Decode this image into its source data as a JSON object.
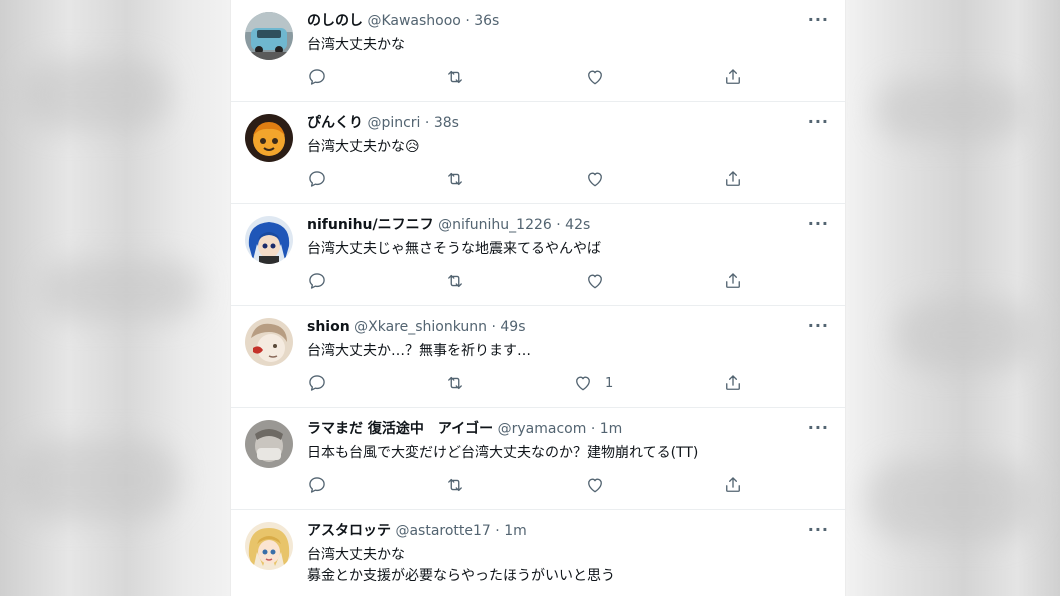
{
  "tweets": [
    {
      "display_name": "のしのし",
      "handle": "@Kawashooo",
      "time": "36s",
      "lines": [
        "台湾大丈夫かな"
      ],
      "avatar": "car-avatar",
      "like_count": ""
    },
    {
      "display_name": "ぴんくり",
      "handle": "@pincri",
      "time": "38s",
      "lines": [
        "台湾大丈夫かな😥"
      ],
      "avatar": "cartoon-face-avatar",
      "like_count": ""
    },
    {
      "display_name": "nifunihu/ニフニフ",
      "handle": "@nifunihu_1226",
      "time": "42s",
      "lines": [
        "台湾大丈夫じゃ無さそうな地震来てるやんやば"
      ],
      "avatar": "blue-hair-anime-avatar",
      "like_count": ""
    },
    {
      "display_name": "shion",
      "handle": "@Xkare_shionkunn",
      "time": "49s",
      "lines": [
        "台湾大丈夫か…？無事を祈ります…"
      ],
      "avatar": "sketch-face-avatar",
      "like_count": "1"
    },
    {
      "display_name": "ラマまだ 復活途中　アイゴー",
      "handle": "@ryamacom",
      "time": "1m",
      "lines": [
        "日本も台風で大変だけど台湾大丈夫なのか？建物崩れてる(TT)"
      ],
      "avatar": "gray-photo-avatar",
      "like_count": ""
    },
    {
      "display_name": "アスタロッテ",
      "handle": "@astarotte17",
      "time": "1m",
      "lines": [
        "台湾大丈夫かな",
        "募金とか支援が必要ならやったほうがいいと思う"
      ],
      "avatar": "blonde-anime-avatar",
      "like_count": ""
    }
  ],
  "icons": {
    "reply": "reply-icon",
    "retweet": "retweet-icon",
    "like": "like-icon",
    "share": "share-icon",
    "more": "more-icon"
  },
  "colors": {
    "text": "#0f1419",
    "secondary": "#536471",
    "divider": "#ebeef0"
  }
}
